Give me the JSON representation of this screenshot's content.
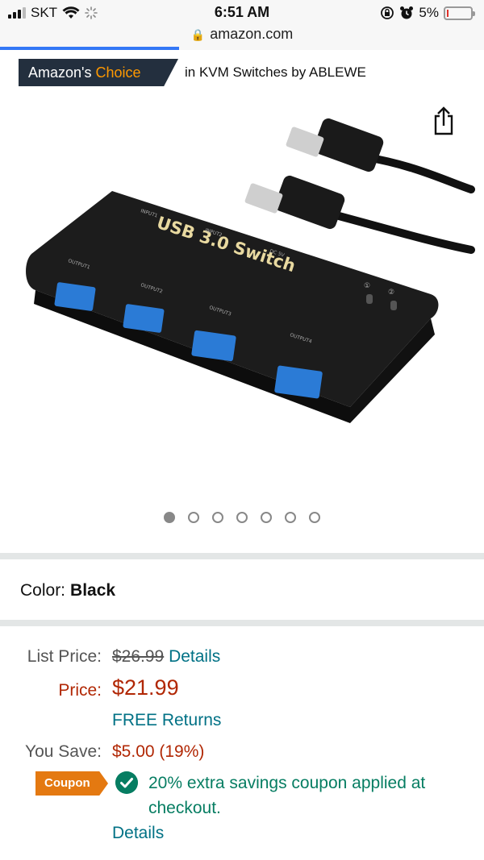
{
  "status_bar": {
    "carrier": "SKT",
    "time": "6:51 AM",
    "battery_pct": "5%"
  },
  "url_bar": {
    "domain": "amazon.com",
    "load_progress": 0.37
  },
  "badge": {
    "label_part1": "Amazon's ",
    "label_part2": "Choice",
    "context": "in KVM Switches by ABLEWE"
  },
  "product_image": {
    "brand_text": "USB 3.0 Switch",
    "port_labels": [
      "INPUT1",
      "INPUT2",
      "DC 5V",
      "OUTPUT1",
      "OUTPUT2",
      "OUTPUT3",
      "OUTPUT4"
    ],
    "indicator_labels": [
      "①",
      "②"
    ],
    "carousel_total": 7,
    "carousel_active": 1
  },
  "color": {
    "label": "Color:",
    "value": "Black"
  },
  "pricing": {
    "list_price_label": "List Price:",
    "list_price": "$26.99",
    "details_link": "Details",
    "price_label": "Price:",
    "price": "$21.99",
    "free_returns": "FREE Returns",
    "you_save_label": "You Save:",
    "you_save": "$5.00 (19%)"
  },
  "coupon": {
    "badge": "Coupon",
    "text": "20% extra savings coupon applied at checkout.",
    "details_link": "Details"
  },
  "colors": {
    "amazon_dark": "#232f3e",
    "amazon_orange": "#ff9900",
    "price_red": "#b12704",
    "link_teal": "#007185",
    "coupon_green": "#067d62",
    "coupon_orange": "#e47911"
  }
}
